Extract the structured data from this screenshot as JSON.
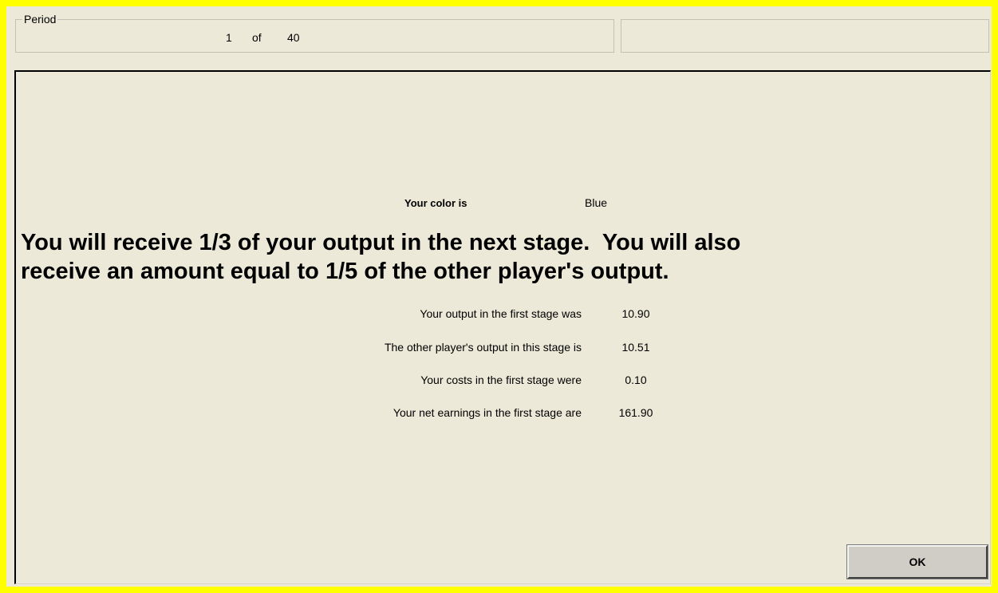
{
  "period": {
    "legend": "Period",
    "current": "1",
    "of_label": "of",
    "total": "40"
  },
  "main": {
    "color_label": "Your color is",
    "color_value": "Blue",
    "headline_line1": "You will receive 1/3 of your output in the next stage.  You will also",
    "headline_line2": "receive an amount equal to 1/5 of the other player's output.",
    "rows": [
      {
        "label": "Your output in the first stage was",
        "value": "10.90"
      },
      {
        "label": "The other player's output in this stage is",
        "value": "10.51"
      },
      {
        "label": "Your costs in the first stage were",
        "value": "0.10"
      },
      {
        "label": "Your net earnings in the first stage are",
        "value": "161.90"
      }
    ],
    "ok_label": "OK"
  },
  "colors": {
    "background": "#ffff00",
    "panel": "#ece9d8",
    "button": "#cfcdc6"
  }
}
